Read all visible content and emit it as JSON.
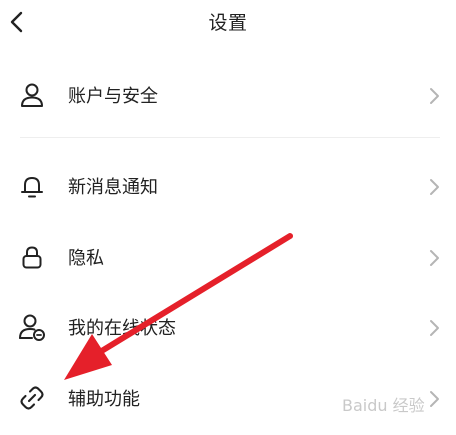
{
  "header": {
    "title": "设置",
    "back_icon": "chevron-left-icon"
  },
  "menu": {
    "items": [
      {
        "label": "账户与安全",
        "icon": "user-icon"
      },
      {
        "label": "新消息通知",
        "icon": "bell-icon"
      },
      {
        "label": "隐私",
        "icon": "lock-icon"
      },
      {
        "label": "我的在线状态",
        "icon": "user-status-icon"
      },
      {
        "label": "辅助功能",
        "icon": "link-icon"
      }
    ]
  },
  "annotation": {
    "arrow_color": "#e5202a",
    "watermark": "Baidu 经验"
  },
  "colors": {
    "text": "#222222",
    "chevron": "#b5b5b5",
    "divider": "#eeeeee"
  }
}
